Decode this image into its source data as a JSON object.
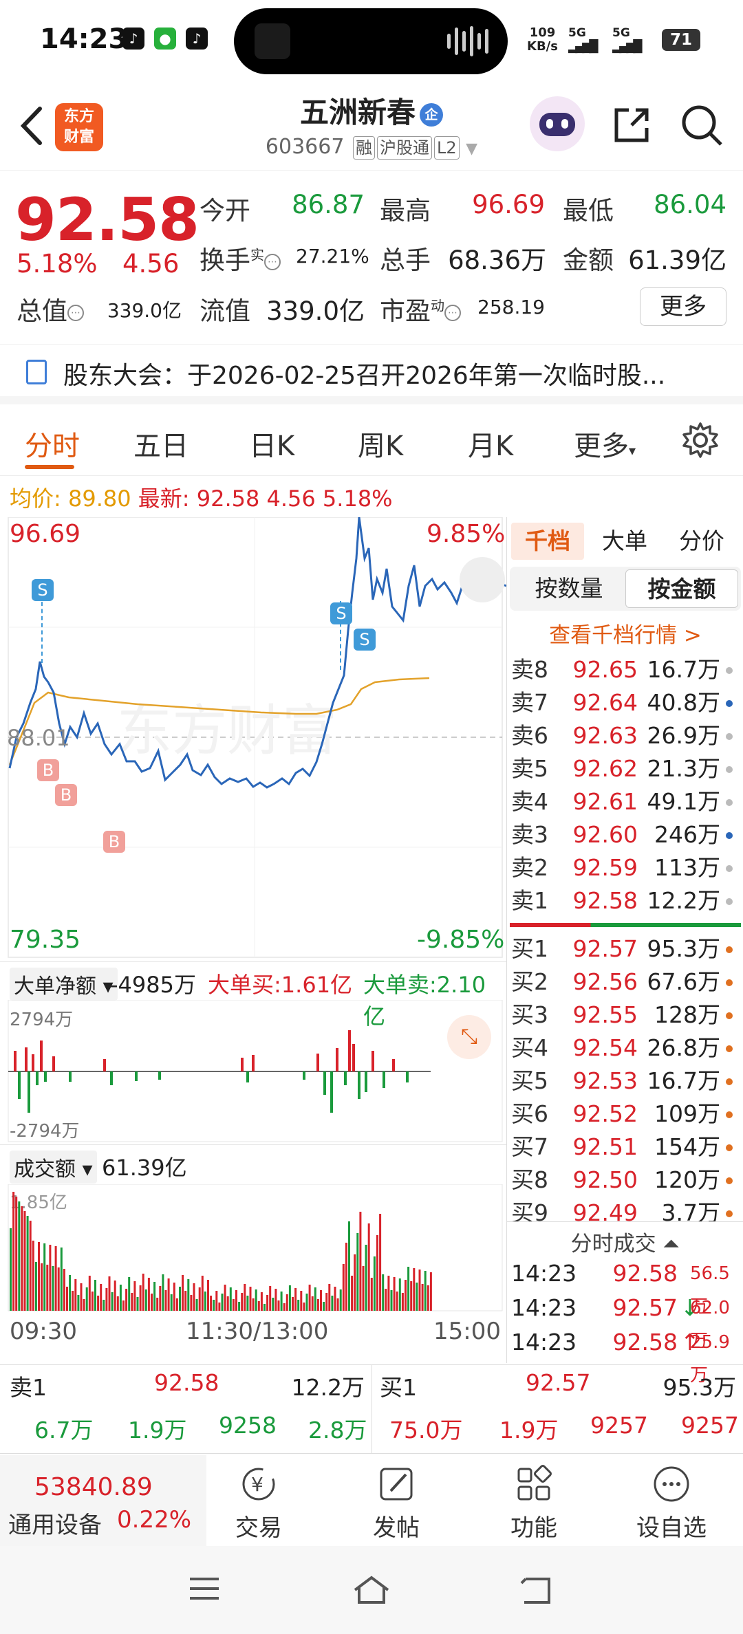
{
  "status_bar": {
    "time": "14:23",
    "net_speed_value": "109",
    "net_speed_unit": "KB/s",
    "signal1": "5G",
    "signal2": "5G",
    "battery": "71"
  },
  "header": {
    "stock_name": "五洲新春",
    "qi_badge": "企",
    "code": "603667",
    "tags": [
      "融",
      "沪股通",
      "L2"
    ],
    "logo_line1": "东方",
    "logo_line2": "财富"
  },
  "quote": {
    "price": "92.58",
    "change_pct": "5.18%",
    "change": "4.56",
    "open_label": "今开",
    "open": "86.87",
    "high_label": "最高",
    "high": "96.69",
    "low_label": "最低",
    "low": "86.04",
    "turnover_label": "换手",
    "turnover_sup": "实",
    "turnover": "27.21%",
    "volume_label": "总手",
    "volume": "68.36万",
    "amount_label": "金额",
    "amount": "61.39亿",
    "mcap_label": "总值",
    "mcap": "339.0亿",
    "float_label": "流值",
    "float": "339.0亿",
    "pe_label": "市盈",
    "pe_sup": "动",
    "pe": "258.19",
    "more": "更多"
  },
  "notice": {
    "text": "股东大会：于2026-02-25召开2026年第一次临时股..."
  },
  "tabs": [
    "分时",
    "五日",
    "日K",
    "周K",
    "月K",
    "更多"
  ],
  "avg_line": {
    "avg_label": "均价:",
    "avg": "89.80",
    "latest_label": "最新:",
    "latest": "92.58",
    "chg": "4.56",
    "pct": "5.18%"
  },
  "chart_labels": {
    "max": "96.69",
    "min": "79.35",
    "max_pct": "9.85%",
    "min_pct": "-9.85%",
    "mid": "88.01",
    "times": [
      "09:30",
      "11:30/13:00",
      "15:00"
    ],
    "marker_s": "S",
    "marker_b": "B"
  },
  "flow": {
    "selector": "大单净额",
    "net": "-4985万",
    "buy_label": "大单买:",
    "buy": "1.61亿",
    "sell_label": "大单卖:",
    "sell": "2.10亿",
    "top": "2794万",
    "bottom": "-2794万"
  },
  "volume_pane": {
    "selector": "成交额",
    "total": "61.39亿",
    "top": "1.85亿"
  },
  "right_panel": {
    "tabs": [
      "千档",
      "大单",
      "分价"
    ],
    "segs": [
      "按数量",
      "按金额"
    ],
    "link": "查看千档行情 >",
    "sells": [
      [
        "卖8",
        "92.65",
        "16.7万"
      ],
      [
        "卖7",
        "92.64",
        "40.8万"
      ],
      [
        "卖6",
        "92.63",
        "26.9万"
      ],
      [
        "卖5",
        "92.62",
        "21.3万"
      ],
      [
        "卖4",
        "92.61",
        "49.1万"
      ],
      [
        "卖3",
        "92.60",
        "246万"
      ],
      [
        "卖2",
        "92.59",
        "113万"
      ],
      [
        "卖1",
        "92.58",
        "12.2万"
      ]
    ],
    "buys": [
      [
        "买1",
        "92.57",
        "95.3万"
      ],
      [
        "买2",
        "92.56",
        "67.6万"
      ],
      [
        "买3",
        "92.55",
        "128万"
      ],
      [
        "买4",
        "92.54",
        "26.8万"
      ],
      [
        "买5",
        "92.53",
        "16.7万"
      ],
      [
        "买6",
        "92.52",
        "109万"
      ],
      [
        "买7",
        "92.51",
        "154万"
      ],
      [
        "买8",
        "92.50",
        "120万"
      ],
      [
        "买9",
        "92.49",
        "3.7万"
      ]
    ],
    "ticks_title": "分时成交",
    "ticks": [
      [
        "14:23",
        "92.58",
        "56.5万",
        ""
      ],
      [
        "14:23",
        "92.57",
        "62.0万",
        "↓"
      ],
      [
        "14:23",
        "92.58",
        "25.9万",
        "↑"
      ]
    ]
  },
  "bottom_quote": {
    "sell1_label": "卖1",
    "sell1_price": "92.58",
    "sell1_vol": "12.2万",
    "buy1_label": "买1",
    "buy1_price": "92.57",
    "buy1_vol": "95.3万",
    "left_row": [
      "6.7万",
      "1.9万",
      "9258",
      "2.8万"
    ],
    "right_row": [
      "75.0万",
      "1.9万",
      "9257",
      "9257"
    ]
  },
  "toolbar": {
    "index_value": "53840.89",
    "index_name": "通用设备",
    "index_pct": "0.22%",
    "items": [
      "交易",
      "发帖",
      "功能",
      "设自选"
    ]
  },
  "colors": {
    "up": "#d8222a",
    "down": "#1a9a3c",
    "accent": "#e05a12",
    "price_line": "#2a66b8",
    "avg_line": "#e3a22b"
  }
}
